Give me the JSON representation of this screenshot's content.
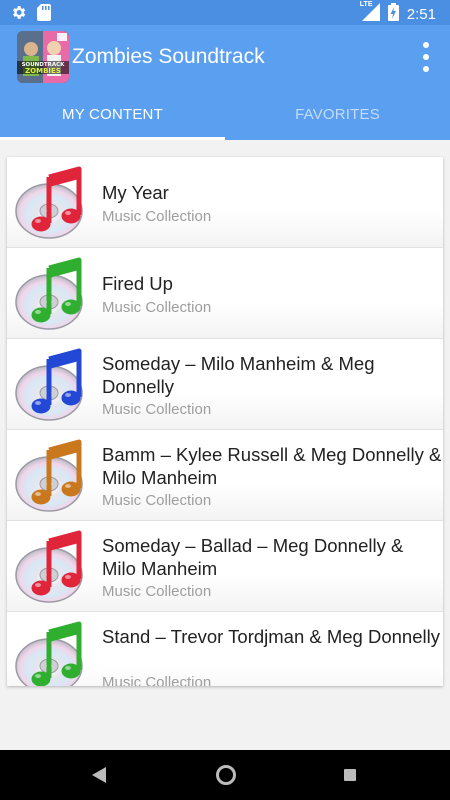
{
  "status": {
    "time": "2:51",
    "network": "LTE"
  },
  "app": {
    "title": "Zombies Soundtrack",
    "icon_text": [
      "SOUNDTRACK",
      "ZOMBIES"
    ]
  },
  "tabs": [
    {
      "label": "MY CONTENT",
      "active": true
    },
    {
      "label": "FAVORITES",
      "active": false
    }
  ],
  "items": [
    {
      "title": "My Year",
      "subtitle": "Music Collection",
      "note_color": "#e0243a"
    },
    {
      "title": "Fired Up",
      "subtitle": "Music Collection",
      "note_color": "#2fae2f"
    },
    {
      "title": "Someday – Milo Manheim & Meg Donnelly",
      "subtitle": "Music Collection",
      "note_color": "#2448d6"
    },
    {
      "title": "Bamm – Kylee Russell & Meg Donnelly & Milo Manheim",
      "subtitle": "Music Collection",
      "note_color": "#c9781e"
    },
    {
      "title": "Someday – Ballad – Meg Donnelly & Milo Manheim",
      "subtitle": "Music Collection",
      "note_color": "#e0243a"
    },
    {
      "title": "Stand – Trevor Tordjman & Meg Donnelly",
      "subtitle": "Music Collection",
      "note_color": "#2fae2f"
    }
  ],
  "colors": {
    "appbar": "#5b9ff0",
    "statusbar": "#4a8fe2"
  }
}
